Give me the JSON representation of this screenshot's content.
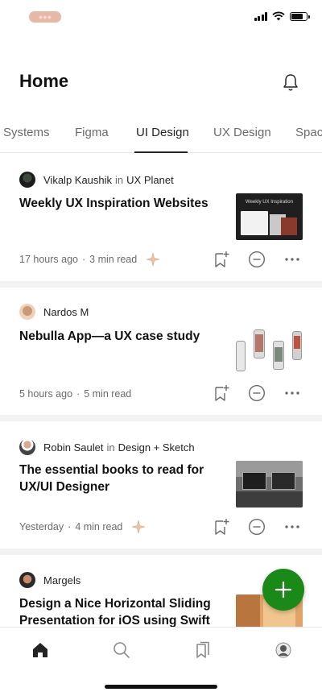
{
  "status_bar": {
    "pill_text": "●●●"
  },
  "header": {
    "title": "Home"
  },
  "tabs": [
    {
      "label": "Systems",
      "active": false
    },
    {
      "label": "Figma",
      "active": false
    },
    {
      "label": "UI Design",
      "active": true
    },
    {
      "label": "UX Design",
      "active": false
    },
    {
      "label": "Spac",
      "active": false
    }
  ],
  "articles": [
    {
      "author": "Vikalp Kaushik",
      "in_word": "in",
      "publication": "UX Planet",
      "title": "Weekly UX Inspiration Websites",
      "thumb_text": "Weekly UX Inspiration",
      "time": "17 hours ago",
      "read_time": "3 min read",
      "starred": true
    },
    {
      "author": "Nardos M",
      "in_word": "",
      "publication": "",
      "title": "Nebulla App—a UX case study",
      "time": "5 hours ago",
      "read_time": "5 min read",
      "starred": false
    },
    {
      "author": "Robin Saulet",
      "in_word": "in",
      "publication": "Design + Sketch",
      "title": "The essential books to read for UX/UI Designer",
      "time": "Yesterday",
      "read_time": "4 min read",
      "starred": true
    },
    {
      "author": "Margels",
      "in_word": "",
      "publication": "",
      "title": "Design a Nice Horizontal Sliding Presentation for iOS using Swift"
    }
  ],
  "colors": {
    "accent_green": "#1a8917",
    "star": "#d8a47f"
  },
  "icons": [
    "bell-icon",
    "bookmark-add-icon",
    "minus-circle-icon",
    "more-icon",
    "plus-icon",
    "home-icon",
    "search-icon",
    "bookmarks-icon",
    "profile-icon"
  ]
}
